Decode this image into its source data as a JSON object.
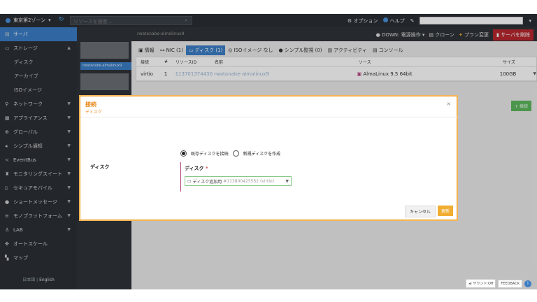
{
  "topbar": {
    "zone": "東京第2ゾーン",
    "search_placeholder": "リソースを検索...",
    "options": "オプション",
    "help": "ヘルプ"
  },
  "sidebar": {
    "items": [
      {
        "label": "サーバ",
        "icon": "server-icon"
      },
      {
        "label": "ストレージ",
        "icon": "storage-icon"
      },
      {
        "label": "ディスク"
      },
      {
        "label": "アーカイブ"
      },
      {
        "label": "ISOイメージ"
      },
      {
        "label": "ネットワーク",
        "icon": "network-icon"
      },
      {
        "label": "アプライアンス",
        "icon": "appliance-icon"
      },
      {
        "label": "グローバル",
        "icon": "globe-icon"
      },
      {
        "label": "シンプル通知",
        "icon": "notification-icon"
      },
      {
        "label": "EventBus",
        "icon": "eventbus-icon"
      },
      {
        "label": "モニタリングスイート",
        "icon": "monitoring-icon"
      },
      {
        "label": "セキュアモバイル",
        "icon": "mobile-icon"
      },
      {
        "label": "ショートメッセージ",
        "icon": "message-icon"
      },
      {
        "label": "モノプラットフォーム",
        "icon": "platform-icon"
      },
      {
        "label": "LAB",
        "icon": "lab-icon"
      },
      {
        "label": "オートスケール",
        "icon": "autoscale-icon"
      },
      {
        "label": "マップ",
        "icon": "map-icon"
      }
    ],
    "lang_ja": "日本語",
    "lang_en": "English"
  },
  "rescol": {
    "item": "rwatanabe-almalinux9"
  },
  "header": {
    "title": "rwatanabe-almalinux9",
    "status": "DOWN: 電源操作",
    "clone": "クローン",
    "plan": "プラン変更",
    "delete": "サーバを削除"
  },
  "tabs": [
    {
      "label": "情報"
    },
    {
      "label": "NIC (1)"
    },
    {
      "label": "ディスク (1)"
    },
    {
      "label": "ISOイメージ なし"
    },
    {
      "label": "シンプル監視 (0)"
    },
    {
      "label": "アクティビティ"
    },
    {
      "label": "コンソール"
    }
  ],
  "table": {
    "headers": [
      "接続",
      "#",
      "リソースID",
      "名前",
      "ソース",
      "サイズ"
    ],
    "rows": [
      [
        "virtio",
        "1",
        "113701374430",
        "rwatanabe-almalinux9",
        "AlmaLinux 9.5 64bit",
        "100GB"
      ]
    ],
    "connect_button": "接続"
  },
  "modal": {
    "title": "接続",
    "subtitle": "ディスク",
    "left_label": "ディスク",
    "radio_existing": "既存ディスクを接続",
    "radio_new": "新規ディスクを作成",
    "field_label": "ディスク",
    "required_mark": "*",
    "select_value": "ディスク追加用",
    "select_muted": "#113800425552 (virtio)",
    "cancel": "キャンセル",
    "ok": "更新"
  },
  "footer": {
    "sound": "サウンド:Off",
    "feedback": "FEEDBACK"
  },
  "colors": {
    "accent": "#3b7ec6",
    "modal_border": "#f0a030",
    "danger": "#b7282e",
    "primary_button": "#f0ad32"
  }
}
